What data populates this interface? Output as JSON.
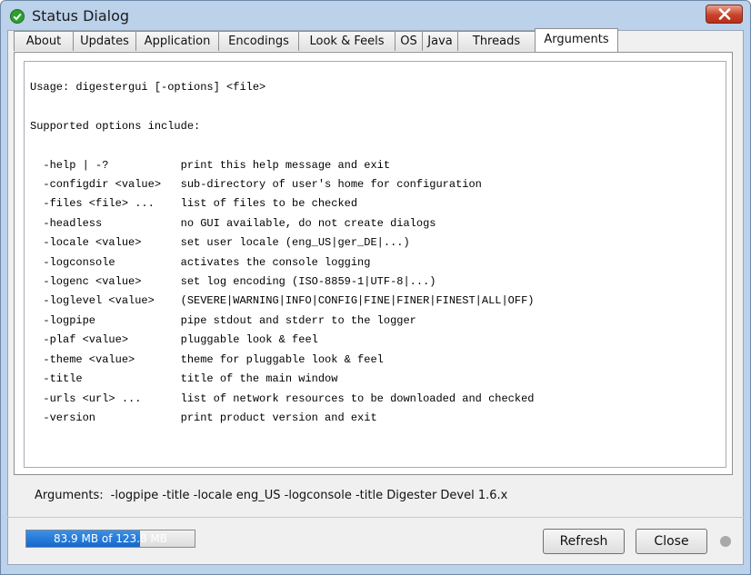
{
  "window": {
    "title": "Status Dialog",
    "icon": "green-checkmark-icon",
    "close_icon": "close-x-icon",
    "accent_close": "#c8432c"
  },
  "tabs": [
    {
      "label": "About"
    },
    {
      "label": "Updates"
    },
    {
      "label": "Application"
    },
    {
      "label": "Encodings"
    },
    {
      "label": "Look & Feels"
    },
    {
      "label": "OS"
    },
    {
      "label": "Java"
    },
    {
      "label": "Threads"
    },
    {
      "label": "Arguments",
      "active": true
    }
  ],
  "arguments_panel": {
    "usage": "Usage: digestergui [-options] <file>",
    "supported": "Supported options include:",
    "options": [
      {
        "flag": "-help | -?",
        "desc": "print this help message and exit"
      },
      {
        "flag": "-configdir <value>",
        "desc": "sub-directory of user's home for configuration"
      },
      {
        "flag": "-files <file> ...",
        "desc": "list of files to be checked"
      },
      {
        "flag": "-headless",
        "desc": "no GUI available, do not create dialogs"
      },
      {
        "flag": "-locale <value>",
        "desc": "set user locale (eng_US|ger_DE|...)"
      },
      {
        "flag": "-logconsole",
        "desc": "activates the console logging"
      },
      {
        "flag": "-logenc <value>",
        "desc": "set log encoding (ISO-8859-1|UTF-8|...)"
      },
      {
        "flag": "-loglevel <value>",
        "desc": "(SEVERE|WARNING|INFO|CONFIG|FINE|FINER|FINEST|ALL|OFF)"
      },
      {
        "flag": "-logpipe",
        "desc": "pipe stdout and stderr to the logger"
      },
      {
        "flag": "-plaf <value>",
        "desc": "pluggable look & feel"
      },
      {
        "flag": "-theme <value>",
        "desc": "theme for pluggable look & feel"
      },
      {
        "flag": "-title",
        "desc": "title of the main window"
      },
      {
        "flag": "-urls <url> ...",
        "desc": "list of network resources to be downloaded and checked"
      },
      {
        "flag": "-version",
        "desc": "print product version and exit"
      }
    ],
    "arguments_label": "Arguments:",
    "arguments_value": "-logpipe -title -locale eng_US -logconsole -title Digester Devel 1.6.x"
  },
  "footer": {
    "memory_text": "83.9 MB of 123.8 MB",
    "memory_used_mb": 83.9,
    "memory_total_mb": 123.8,
    "memory_color": "#1669cc",
    "refresh_label": "Refresh",
    "close_label": "Close",
    "status_indicator_color": "#a9a9a9"
  }
}
